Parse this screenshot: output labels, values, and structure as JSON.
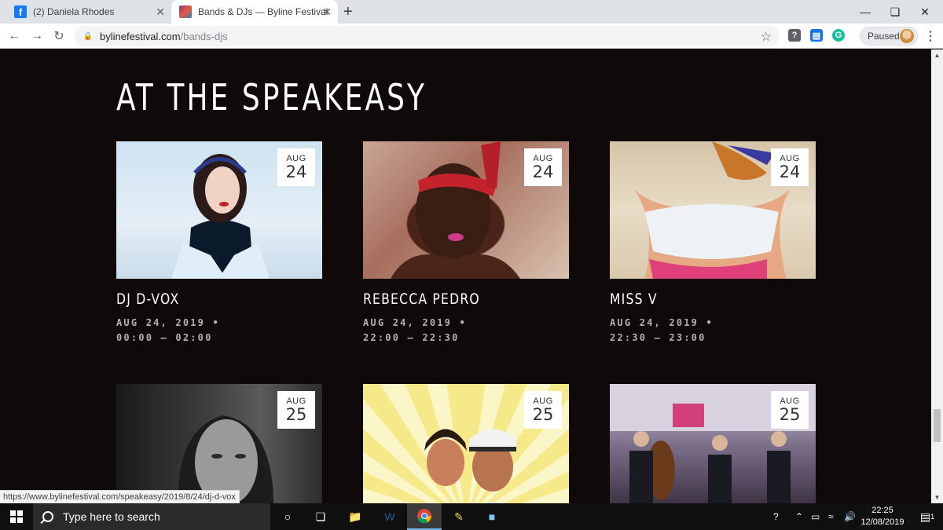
{
  "browser": {
    "tabs": [
      {
        "title": "(2) Daniela Rhodes",
        "active": false,
        "icon": "facebook-icon"
      },
      {
        "title": "Bands & DJs — Byline Festival",
        "active": true,
        "icon": "byline-festival-icon"
      }
    ],
    "url_host": "bylinefestival.com",
    "url_path": "/bands-djs",
    "profile_status": "Paused",
    "status_url": "https://www.bylinefestival.com/speakeasy/2019/8/24/dj-d-vox"
  },
  "page": {
    "heading": "AT THE SPEAKEASY",
    "events": [
      {
        "name": "DJ D-VOX",
        "month": "AUG",
        "day": "24",
        "date_line": "AUG 24, 2019 •",
        "time_line": "00:00 – 02:00"
      },
      {
        "name": "REBECCA PEDRO",
        "month": "AUG",
        "day": "24",
        "date_line": "AUG 24, 2019 •",
        "time_line": "22:00 – 22:30"
      },
      {
        "name": "MISS V",
        "month": "AUG",
        "day": "24",
        "date_line": "AUG 24, 2019 •",
        "time_line": "22:30 – 23:00"
      },
      {
        "name": "",
        "month": "AUG",
        "day": "25",
        "date_line": "",
        "time_line": ""
      },
      {
        "name": "",
        "month": "AUG",
        "day": "25",
        "date_line": "",
        "time_line": ""
      },
      {
        "name": "",
        "month": "AUG",
        "day": "25",
        "date_line": "",
        "time_line": ""
      }
    ]
  },
  "taskbar": {
    "search_placeholder": "Type here to search",
    "time": "22:25",
    "date": "12/08/2019",
    "notification_count": "1"
  },
  "colors": {
    "page_bg": "#0f0909",
    "heading": "#ffffff",
    "meta_text": "#b5b0ae",
    "facebook": "#1877f2"
  }
}
